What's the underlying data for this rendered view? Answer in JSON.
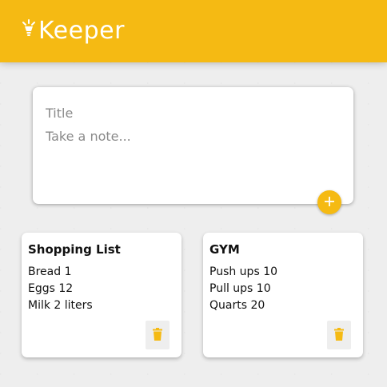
{
  "header": {
    "app_title": "Keeper",
    "brand_color": "#f5ba13",
    "logo_icon": "lightbulb-icon"
  },
  "composer": {
    "title_placeholder": "Title",
    "body_placeholder": "Take a note...",
    "add_icon": "plus-icon"
  },
  "notes": [
    {
      "title": "Shopping List",
      "lines": [
        "Bread 1",
        "Eggs 12",
        "Milk 2 liters"
      ],
      "delete_icon": "trash-icon"
    },
    {
      "title": "GYM",
      "lines": [
        "Push ups 10",
        "Pull ups 10",
        "Quarts 20"
      ],
      "delete_icon": "trash-icon"
    }
  ]
}
